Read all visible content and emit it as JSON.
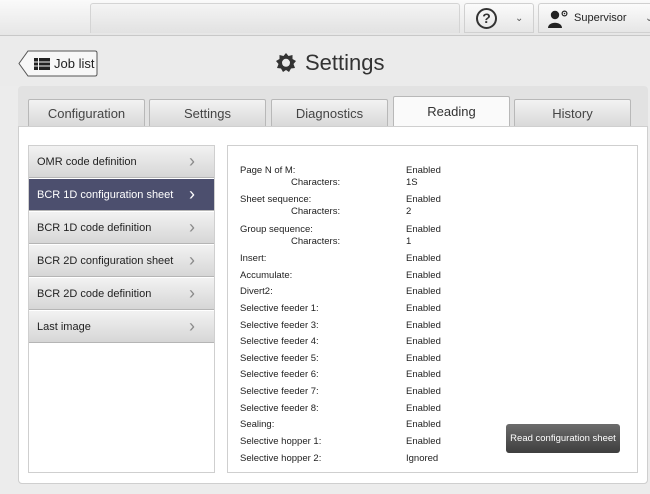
{
  "topbar": {
    "help_glyph": "?",
    "user": {
      "label": "Supervisor"
    }
  },
  "header": {
    "back_label": "Job list",
    "title": "Settings"
  },
  "tabs": [
    {
      "label": "Configuration",
      "active": false
    },
    {
      "label": "Settings",
      "active": false
    },
    {
      "label": "Diagnostics",
      "active": false
    },
    {
      "label": "Reading",
      "active": true
    },
    {
      "label": "History",
      "active": false
    }
  ],
  "menu": [
    {
      "label": "OMR code definition",
      "selected": false
    },
    {
      "label": "BCR 1D configuration sheet",
      "selected": true
    },
    {
      "label": "BCR 1D code definition",
      "selected": false
    },
    {
      "label": "BCR 2D configuration sheet",
      "selected": false
    },
    {
      "label": "BCR 2D code definition",
      "selected": false
    },
    {
      "label": "Last image",
      "selected": false
    }
  ],
  "detail": {
    "rows": [
      {
        "key": "Page N of M:",
        "value": "Enabled",
        "sub": false
      },
      {
        "key": "Characters:",
        "value": "1S",
        "sub": true
      },
      {
        "key": "Sheet sequence:",
        "value": "Enabled",
        "sub": false
      },
      {
        "key": "Characters:",
        "value": "2",
        "sub": true
      },
      {
        "key": "Group sequence:",
        "value": "Enabled",
        "sub": false
      },
      {
        "key": "Characters:",
        "value": "1",
        "sub": true
      },
      {
        "key": "Insert:",
        "value": "Enabled",
        "sub": false
      },
      {
        "key": "Accumulate:",
        "value": "Enabled",
        "sub": false
      },
      {
        "key": "Divert2:",
        "value": "Enabled",
        "sub": false
      },
      {
        "key": "Selective feeder 1:",
        "value": "Enabled",
        "sub": false
      },
      {
        "key": "Selective feeder 3:",
        "value": "Enabled",
        "sub": false
      },
      {
        "key": "Selective feeder 4:",
        "value": "Enabled",
        "sub": false
      },
      {
        "key": "Selective feeder 5:",
        "value": "Enabled",
        "sub": false
      },
      {
        "key": "Selective feeder 6:",
        "value": "Enabled",
        "sub": false
      },
      {
        "key": "Selective feeder 7:",
        "value": "Enabled",
        "sub": false
      },
      {
        "key": "Selective feeder 8:",
        "value": "Enabled",
        "sub": false
      },
      {
        "key": "Sealing:",
        "value": "Enabled",
        "sub": false
      },
      {
        "key": "Selective hopper 1:",
        "value": "Enabled",
        "sub": false
      },
      {
        "key": "Selective hopper 2:",
        "value": "Ignored",
        "sub": false
      }
    ],
    "read_button_label": "Read configuration sheet"
  }
}
